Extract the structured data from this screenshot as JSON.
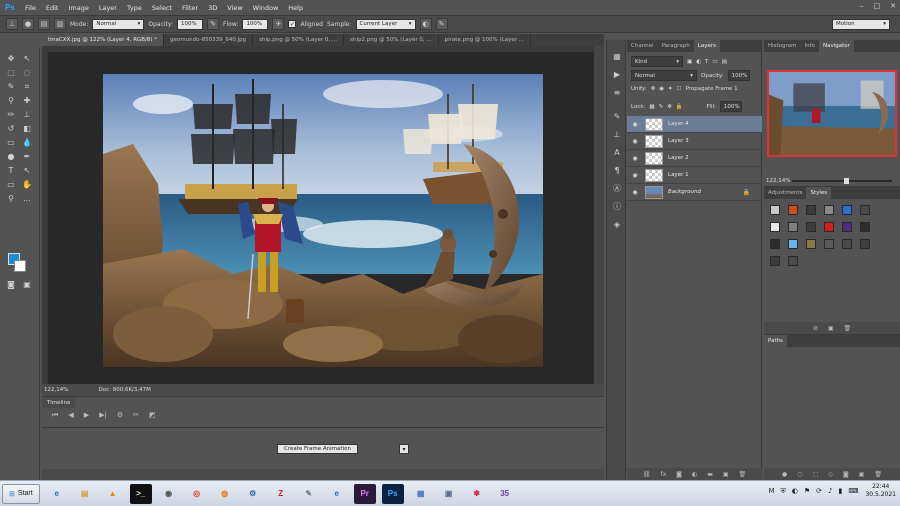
{
  "app": {
    "logo": "Ps"
  },
  "menu": [
    "File",
    "Edit",
    "Image",
    "Layer",
    "Type",
    "Select",
    "Filter",
    "3D",
    "View",
    "Window",
    "Help"
  ],
  "window_controls": [
    "–",
    "□",
    "✕"
  ],
  "options_bar": {
    "mode_label": "Mode:",
    "mode_value": "Normal",
    "opacity_label": "Opacity:",
    "opacity_value": "100%",
    "flow_label": "Flow:",
    "flow_value": "100%",
    "aligned_label": "Aligned",
    "sample_label": "Sample:",
    "sample_value": "Current Layer",
    "workspace_value": "Motion"
  },
  "doc_tabs": [
    "tmaCXX.jpg @ 122% (Layer 4, RGB/8) *",
    "geomundo-850339_640.jpg",
    "ship.png @ 50% (Layer 0, ...",
    "ship2.png @ 50% (Layer 0, ...",
    "pirate.png @ 100% (Layer ..."
  ],
  "status": {
    "zoom": "122,14%",
    "doc": "Doc: 800,6K/3,47M"
  },
  "timeline": {
    "tab_label": "Timeline",
    "create_button": "Create Frame Animation"
  },
  "layers_panel": {
    "tabs": [
      "Channel",
      "Paragraph",
      "Layers"
    ],
    "filter_kind": "Kind",
    "blend_mode": "Normal",
    "opacity_label": "Opacity:",
    "opacity_value": "100%",
    "unify_label": "Unify:",
    "propagate_label": "Propagate Frame 1",
    "lock_label": "Lock:",
    "fill_label": "Fill:",
    "fill_value": "100%",
    "layers": [
      "Layer 4",
      "Layer 3",
      "Layer 2",
      "Layer 1",
      "Background"
    ]
  },
  "navigator_panel": {
    "tabs": [
      "Histogram",
      "Info",
      "Navigator"
    ],
    "zoom": "122,14%",
    "zoom_fraction": 0.55
  },
  "styles_panel": {
    "tabs": [
      "Adjustments",
      "Styles"
    ],
    "swatches": [
      "#c8c8c8",
      "#d24a1a",
      "#3b3b3b",
      "#8a8a8a",
      "#2d6fd0",
      "#4a4a4a",
      "#e8e8e8",
      "#7f7f7f",
      "#3d3d3d",
      "#d81b1b",
      "#4b2f7a",
      "#2e2e2e",
      "#2a2a2a",
      "#6cb4e8",
      "#8a7a4a",
      "#5a5a5a",
      "#4a4a4a",
      "#3e3e3e",
      "#3a3a3a",
      "#4a4a4a"
    ]
  },
  "paths_panel": {
    "title": "Paths"
  },
  "taskbar": {
    "start_label": "Start",
    "apps": [
      {
        "name": "ie",
        "glyph": "e",
        "color": "#1e73d6"
      },
      {
        "name": "files",
        "glyph": "▤",
        "color": "#c9a23b"
      },
      {
        "name": "vlc",
        "glyph": "▲",
        "color": "#f08a00"
      },
      {
        "name": "terminal",
        "glyph": ">_",
        "color": "#111111"
      },
      {
        "name": "alien",
        "glyph": "◉",
        "color": "#555555"
      },
      {
        "name": "chrome",
        "glyph": "◎",
        "color": "#d9422f"
      },
      {
        "name": "firefox",
        "glyph": "◍",
        "color": "#e8791b"
      },
      {
        "name": "settings",
        "glyph": "⚙",
        "color": "#2e6ab3"
      },
      {
        "name": "filezilla",
        "glyph": "Z",
        "color": "#c4271e"
      },
      {
        "name": "notes",
        "glyph": "✎",
        "color": "#7d7d7d"
      },
      {
        "name": "edge",
        "glyph": "e",
        "color": "#1f6dcf"
      },
      {
        "name": "premiere",
        "glyph": "Pr",
        "color": "#2b1a3a"
      },
      {
        "name": "photoshop",
        "glyph": "Ps",
        "color": "#0c2240"
      },
      {
        "name": "docs",
        "glyph": "▦",
        "color": "#4f79b8"
      },
      {
        "name": "monitor",
        "glyph": "▣",
        "color": "#5a6f8a"
      },
      {
        "name": "paint",
        "glyph": "✱",
        "color": "#cc2a4a"
      },
      {
        "name": "app35",
        "glyph": "35",
        "color": "#6a3fb3"
      }
    ],
    "tray_icons": [
      "M",
      "⛨",
      "◐",
      "⚑",
      "⟳",
      "♪",
      "▮",
      "⌨"
    ],
    "time": "22:44",
    "date": "30.5.2021"
  }
}
